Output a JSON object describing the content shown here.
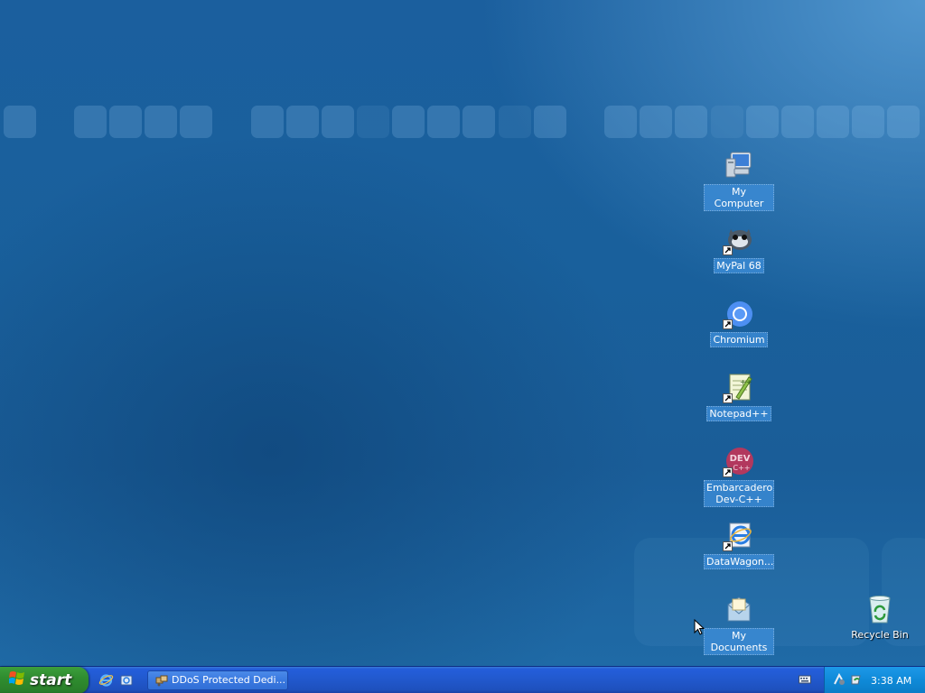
{
  "desktop": {
    "icons": [
      {
        "id": "my-computer",
        "label": "My Computer",
        "icon": "computer-icon",
        "shortcut": false
      },
      {
        "id": "mypal",
        "label": "MyPal 68",
        "icon": "mypal-browser-icon",
        "shortcut": true
      },
      {
        "id": "chromium",
        "label": "Chromium",
        "icon": "chromium-icon",
        "shortcut": true
      },
      {
        "id": "notepadpp",
        "label": "Notepad++",
        "icon": "notepadpp-icon",
        "shortcut": true
      },
      {
        "id": "devcpp",
        "label": "Embarcadero Dev-C++",
        "icon": "devcpp-icon",
        "shortcut": true,
        "icon_text": "DEV"
      },
      {
        "id": "datawagon",
        "label": "DataWagon...",
        "icon": "internet-explorer-icon",
        "shortcut": true
      },
      {
        "id": "my-documents",
        "label": "My Documents",
        "icon": "documents-folder-icon",
        "shortcut": false
      },
      {
        "id": "recycle-bin",
        "label": "Recycle Bin",
        "icon": "recycle-bin-icon",
        "shortcut": false
      }
    ]
  },
  "taskbar": {
    "start_label": "start",
    "quick_launch": [
      {
        "name": "internet-explorer-icon"
      },
      {
        "name": "show-desktop-icon"
      }
    ],
    "task_buttons": [
      {
        "label": "DDoS Protected Dedi...",
        "icon": "network-app-icon"
      }
    ],
    "tray": {
      "icons": [
        "network-icon",
        "update-icon"
      ],
      "clock": "3:38 AM"
    }
  },
  "colors": {
    "desktop_blue": "#1c5c98",
    "taskbar_blue": "#245edb",
    "start_green": "#2f8d2f",
    "tray_blue": "#0f8ad8",
    "selection_blue": "#3c8cd7"
  }
}
